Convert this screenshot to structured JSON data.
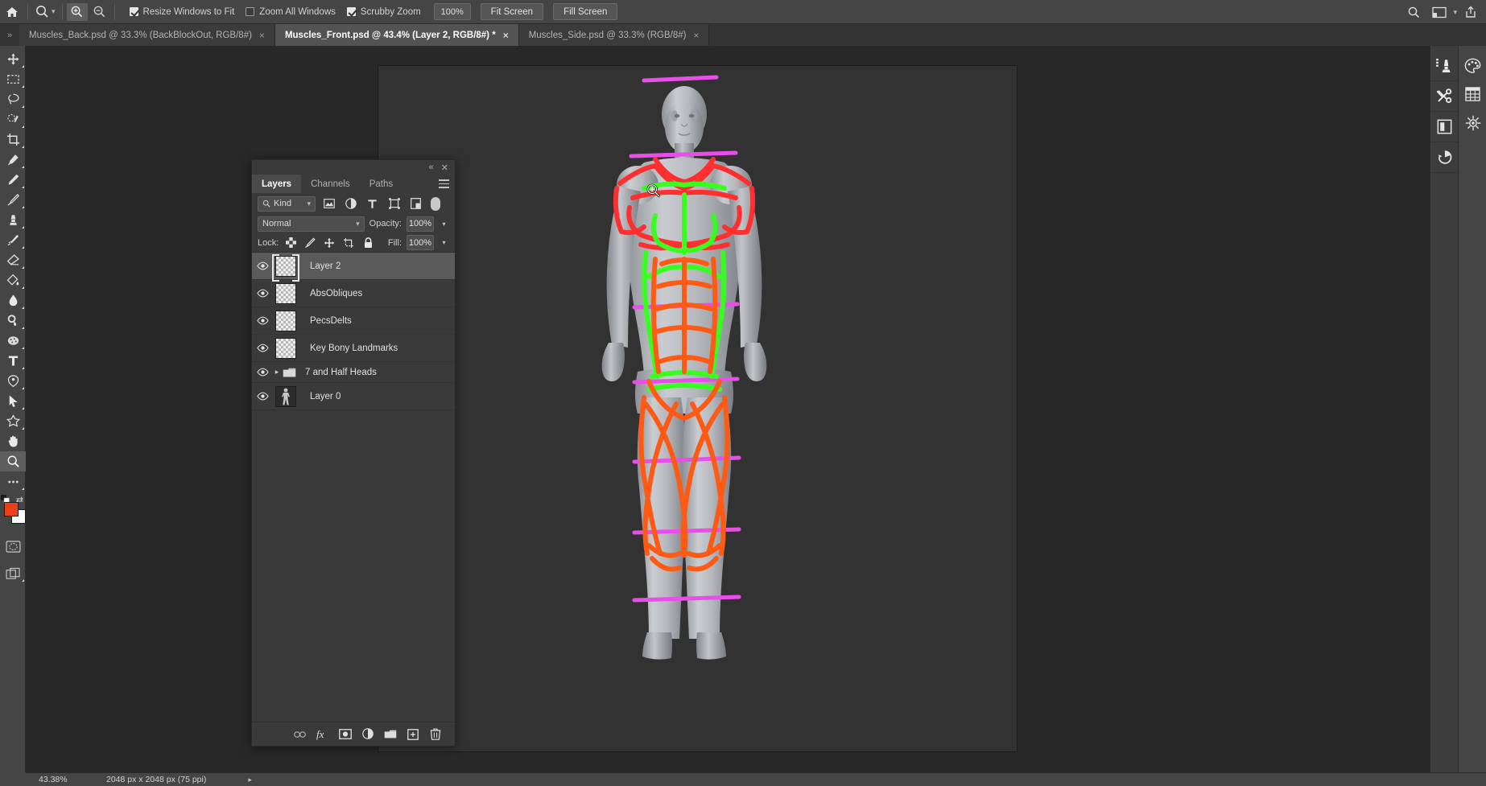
{
  "app": {
    "title": "Adobe Photoshop"
  },
  "options_bar": {
    "home_icon": "home-icon",
    "active_tool": "zoom-tool",
    "tool_preset_icon": "zoom-icon",
    "zoom_in_icon": "zoom-in-icon",
    "zoom_out_icon": "zoom-out-icon",
    "resize_windows_label": "Resize Windows to Fit",
    "resize_windows_checked": true,
    "zoom_all_label": "Zoom All Windows",
    "zoom_all_checked": false,
    "scrubby_label": "Scrubby Zoom",
    "scrubby_checked": true,
    "zoom_value": "100%",
    "fit_screen_label": "Fit Screen",
    "fill_screen_label": "Fill Screen",
    "search_icon": "search-icon",
    "workspace_icon": "workspace-icon",
    "workspace_chevron": "chevron-down-icon",
    "share_icon": "share-icon"
  },
  "tabs": {
    "expand_icon": "chevron-double-right-icon",
    "items": [
      {
        "label": "Muscles_Back.psd @ 33.3% (BackBlockOut, RGB/8#)",
        "active": false,
        "close": "×"
      },
      {
        "label": "Muscles_Front.psd @ 43.4% (Layer 2, RGB/8#) *",
        "active": true,
        "close": "×"
      },
      {
        "label": "Muscles_Side.psd @ 33.3% (RGB/8#)",
        "active": false,
        "close": "×"
      }
    ]
  },
  "toolbar": {
    "tools": [
      {
        "name": "move-tool",
        "selected": false
      },
      {
        "name": "rectangular-marquee-tool",
        "selected": false
      },
      {
        "name": "lasso-tool",
        "selected": false
      },
      {
        "name": "quick-selection-tool",
        "selected": false
      },
      {
        "name": "crop-tool",
        "selected": false
      },
      {
        "name": "eyedropper-tool",
        "selected": false
      },
      {
        "name": "spot-healing-brush-tool",
        "selected": false
      },
      {
        "name": "brush-tool",
        "selected": false
      },
      {
        "name": "clone-stamp-tool",
        "selected": false
      },
      {
        "name": "history-brush-tool",
        "selected": false
      },
      {
        "name": "eraser-tool",
        "selected": false
      },
      {
        "name": "gradient-tool",
        "selected": false
      },
      {
        "name": "blur-tool",
        "selected": false
      },
      {
        "name": "dodge-tool",
        "selected": false
      },
      {
        "name": "sponge-tool",
        "selected": false
      },
      {
        "name": "type-tool",
        "selected": false
      },
      {
        "name": "pen-tool",
        "selected": false
      },
      {
        "name": "path-selection-tool",
        "selected": false
      },
      {
        "name": "shape-tool",
        "selected": false
      },
      {
        "name": "hand-tool",
        "selected": false
      },
      {
        "name": "zoom-tool",
        "selected": true
      },
      {
        "name": "edit-toolbar-button",
        "selected": false
      }
    ],
    "foreground_color": "#e8401a",
    "background_color": "#ffffff",
    "quick_mask_icon": "quick-mask-icon",
    "screen_mode_icon": "screen-mode-icon",
    "swap_colors_icon": "swap-colors-icon",
    "default_colors_icon": "default-colors-icon"
  },
  "layers_panel": {
    "collapse_icon": "collapse-icon",
    "close_icon": "close-icon",
    "menu_icon": "panel-menu-icon",
    "tabs": [
      {
        "label": "Layers",
        "active": true
      },
      {
        "label": "Channels",
        "active": false
      },
      {
        "label": "Paths",
        "active": false
      }
    ],
    "filter": {
      "search_icon": "search-icon",
      "kind_label": "Kind",
      "chevron": "chevron-down-icon",
      "pixel_icon": "pixel-filter-icon",
      "adjustment_icon": "adjustment-filter-icon",
      "type_icon": "type-filter-icon",
      "shape_icon": "shape-filter-icon",
      "smart_object_icon": "smart-object-filter-icon",
      "toggle_icon": "filter-toggle-switch"
    },
    "blend": {
      "mode": "Normal",
      "mode_chevron": "chevron-down-icon",
      "opacity_label": "Opacity:",
      "opacity_value": "100%",
      "opacity_chevron": "chevron-down-icon"
    },
    "lock": {
      "label": "Lock:",
      "transparent_icon": "lock-transparent-pixels-icon",
      "image_icon": "lock-image-pixels-icon",
      "position_icon": "lock-position-icon",
      "artboard_icon": "lock-artboard-nesting-icon",
      "all_icon": "lock-all-icon",
      "fill_label": "Fill:",
      "fill_value": "100%",
      "fill_chevron": "chevron-down-icon"
    },
    "layers": [
      {
        "name": "Layer 2",
        "visible": true,
        "selected": true,
        "kind": "pixel"
      },
      {
        "name": "AbsObliques",
        "visible": true,
        "selected": false,
        "kind": "pixel"
      },
      {
        "name": "PecsDelts",
        "visible": true,
        "selected": false,
        "kind": "pixel"
      },
      {
        "name": "Key Bony Landmarks",
        "visible": true,
        "selected": false,
        "kind": "pixel"
      },
      {
        "name": "7 and Half Heads",
        "visible": true,
        "selected": false,
        "kind": "group"
      },
      {
        "name": "Layer 0",
        "visible": true,
        "selected": false,
        "kind": "image"
      }
    ],
    "footer": {
      "link_icon": "link-layers-icon",
      "fx_icon": "layer-style-fx-icon",
      "mask_icon": "add-layer-mask-icon",
      "adjustment_icon": "new-adjustment-layer-icon",
      "group_icon": "new-group-icon",
      "new_layer_icon": "new-layer-icon",
      "delete_icon": "delete-layer-icon"
    }
  },
  "right_dock": {
    "inner": [
      {
        "name": "libraries-panel-icon"
      },
      {
        "name": "tool-presets-panel-icon"
      },
      {
        "name": "book-panel-icon"
      },
      {
        "name": "history-panel-icon"
      }
    ],
    "outer": [
      {
        "name": "color-panel-icon"
      },
      {
        "name": "swatches-panel-icon"
      },
      {
        "name": "adjustments-panel-icon"
      }
    ]
  },
  "canvas": {
    "document": "Muscles_Front.psd",
    "cursor_icon": "zoom-in-cursor",
    "overlay_colors": {
      "muscle_red": "#ff2f2f",
      "muscle_green": "#36ff1f",
      "muscle_orange": "#ff5a14",
      "guide_magenta": "#e84fe8"
    }
  },
  "status_bar": {
    "zoom": "43.38%",
    "doc_size": "2048 px x 2048 px (75 ppi)",
    "expand_icon": "chevron-right-icon"
  }
}
